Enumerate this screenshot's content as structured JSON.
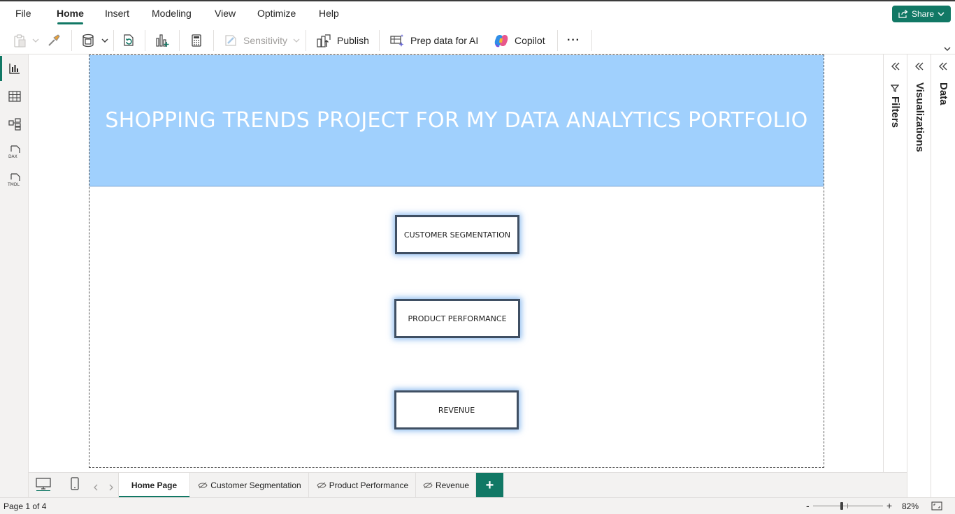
{
  "menu": {
    "items": [
      "File",
      "Home",
      "Insert",
      "Modeling",
      "View",
      "Optimize",
      "Help"
    ],
    "active": "Home",
    "share_label": "Share"
  },
  "ribbon": {
    "sensitivity_label": "Sensitivity",
    "publish_label": "Publish",
    "prep_ai_label": "Prep data for AI",
    "copilot_label": "Copilot",
    "more_label": "···"
  },
  "report": {
    "title": "SHOPPING TRENDS PROJECT FOR MY DATA ANALYTICS PORTFOLIO",
    "buttons": [
      "CUSTOMER SEGMENTATION",
      "PRODUCT PERFORMANCE",
      "REVENUE"
    ],
    "banner_color": "#a0d0fd"
  },
  "panes": {
    "filters_label": "Filters",
    "visualizations_label": "Visualizations",
    "data_label": "Data"
  },
  "tabs": {
    "pages": [
      "Home Page",
      "Customer Segmentation",
      "Product Performance",
      "Revenue"
    ],
    "active": "Home Page",
    "add_label": "+"
  },
  "status": {
    "page_info": "Page 1 of 4",
    "zoom_minus": "-",
    "zoom_plus": "+",
    "zoom_level": "82%",
    "zoom_fraction": 0.41
  },
  "colors": {
    "accent": "#117865",
    "banner": "#a0d0fd"
  }
}
